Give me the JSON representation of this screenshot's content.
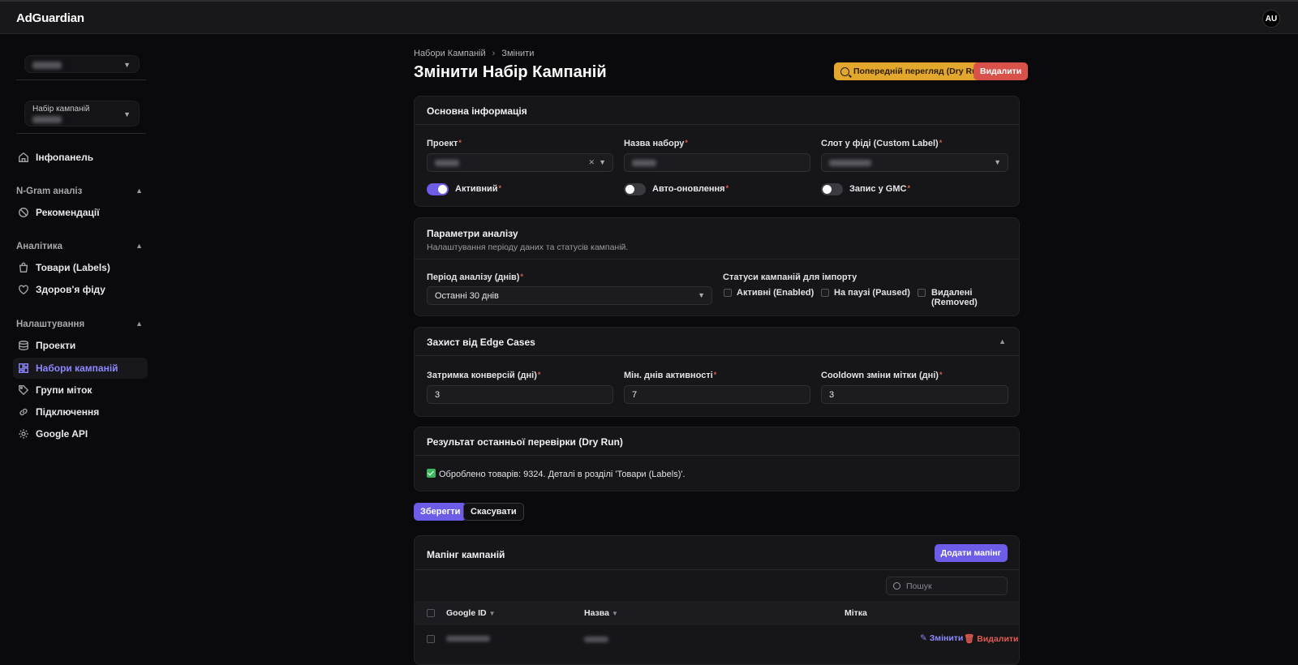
{
  "app": {
    "name": "AdGuardian",
    "user_initials": "AU"
  },
  "sidebar": {
    "project_select_value": "",
    "campaign_set_label": "Набір кампаній",
    "dashboard": "Інфопанель",
    "groups": [
      {
        "title": "N-Gram аналіз",
        "items": [
          "Рекомендації"
        ]
      },
      {
        "title": "Аналітика",
        "items": [
          "Товари (Labels)",
          "Здоров'я фіду"
        ]
      },
      {
        "title": "Налаштування",
        "items": [
          "Проекти",
          "Набори кампаній",
          "Групи міток",
          "Підключення",
          "Google API"
        ]
      }
    ]
  },
  "breadcrumb": {
    "parent": "Набори Кампаній",
    "current": "Змінити"
  },
  "page_title": "Змінити Набір Кампаній",
  "actions": {
    "dry_run": "Попередній перегляд (Dry Run)",
    "delete": "Видалити"
  },
  "basic_info": {
    "title": "Основна інформація",
    "project_label": "Проект",
    "name_label": "Назва набору",
    "slot_label": "Слот у фіді (Custom Label)",
    "active_label": "Активний",
    "active": true,
    "auto_update_label": "Авто-оновлення",
    "auto_update": false,
    "gmc_label": "Запис у GMC",
    "gmc": false
  },
  "analysis": {
    "title": "Параметри аналізу",
    "subtitle": "Налаштування періоду даних та статусів кампаній.",
    "period_label": "Період аналізу (днів)",
    "period_value": "Останні 30 днів",
    "statuses_label": "Статуси кампаній для імпорту",
    "statuses": [
      "Активні (Enabled)",
      "На паузі (Paused)",
      "Видалені (Removed)"
    ]
  },
  "edge": {
    "title": "Захист від Edge Cases",
    "conv_delay_label": "Затримка конверсій (дні)",
    "conv_delay": "3",
    "min_days_label": "Мін. днів активності",
    "min_days": "7",
    "cooldown_label": "Cooldown зміни мітки (дні)",
    "cooldown": "3"
  },
  "result": {
    "title": "Результат останньої перевірки (Dry Run)",
    "message": "Оброблено товарів: 9324. Деталі в розділі 'Товари (Labels)'."
  },
  "form": {
    "save": "Зберегти",
    "cancel": "Скасувати"
  },
  "mapping": {
    "title": "Мапінг кампаній",
    "add": "Додати мапінг",
    "search_placeholder": "Пошук",
    "columns": [
      "Google ID",
      "Назва",
      "Мітка"
    ],
    "row_edit": "Змінити",
    "row_delete": "Видалити"
  },
  "colors": {
    "accent": "#6c5ce7",
    "warning": "#e3a72e",
    "danger": "#d9524a",
    "success": "#3fb760"
  }
}
